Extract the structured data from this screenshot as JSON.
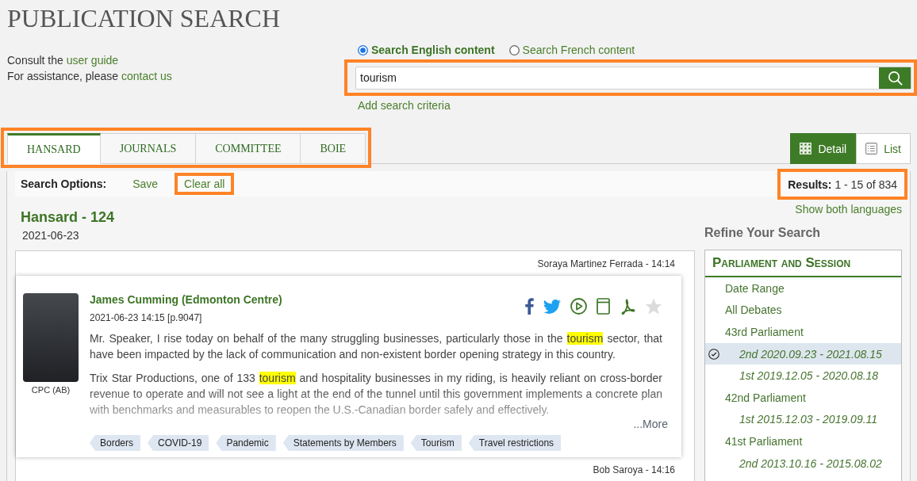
{
  "page": {
    "title": "PUBLICATION SEARCH",
    "help": [
      {
        "text": "Consult the",
        "link": "user guide"
      },
      {
        "text": "For assistance, please",
        "link": "contact us"
      }
    ]
  },
  "search": {
    "languages": [
      {
        "label": "Search English content",
        "selected": true
      },
      {
        "label": "Search French content",
        "selected": false
      }
    ],
    "query": "tourism",
    "highlighted": true,
    "add_criteria": "Add search criteria"
  },
  "tabs": {
    "highlighted": true,
    "items": [
      {
        "label": "HANSARD",
        "selected": true
      },
      {
        "label": "JOURNALS",
        "selected": false
      },
      {
        "label": "COMMITTEE",
        "selected": false
      },
      {
        "label": "BOIE",
        "selected": false
      }
    ]
  },
  "view_toggle": [
    {
      "kind": "grid",
      "label": "Detail",
      "selected": true
    },
    {
      "kind": "list",
      "label": "List",
      "selected": false
    }
  ],
  "search_options": {
    "label": "Search Options:",
    "actions": [
      {
        "label": "Save",
        "highlighted": false
      },
      {
        "label": "Clear all",
        "highlighted": true
      }
    ],
    "results": {
      "label": "Results:",
      "value": "1 - 15 of 834",
      "highlighted": true
    }
  },
  "show_both_languages": "Show both languages",
  "results": {
    "title": "Hansard - 124",
    "date": "2021-06-23",
    "items": [
      {
        "kind": "speaker_line",
        "text": "Soraya Martinez Ferrada - 14:14"
      },
      {
        "kind": "intervention",
        "name": "James Cumming (Edmonton Centre)",
        "affiliation": "CPC (AB)",
        "timestamp": "2021-06-23 14:15 [p.9047]",
        "favorite": false,
        "paragraphs": [
          [
            {
              "text": "Mr. Speaker, I rise today on behalf of the many struggling businesses, particularly those in the ",
              "match": false
            },
            {
              "text": "tourism",
              "match": true
            },
            {
              "text": " sector, that have been impacted by the lack of communication and non-existent border opening strategy in this country.",
              "match": false
            }
          ],
          [
            {
              "text": "Trix Star Productions, one of 133 ",
              "match": false
            },
            {
              "text": "tourism",
              "match": true
            },
            {
              "text": " and hospitality businesses in my riding, is heavily reliant on cross-border revenue to operate and will not see a light at the end of the tunnel until this government implements a concrete plan with benchmarks and measurables to reopen the U.S.-Canadian border safely and effectively.",
              "match": false
            }
          ]
        ],
        "more": "...More",
        "tags": [
          "Borders",
          "COVID-19",
          "Pandemic",
          "Statements by Members",
          "Tourism",
          "Travel restrictions"
        ]
      },
      {
        "kind": "speaker_line",
        "text": "Bob Saroya - 14:16"
      }
    ]
  },
  "refine": {
    "title": "Refine Your Search",
    "facet": {
      "title": "Parliament and Session",
      "items": [
        {
          "label": "Date Range",
          "selected": false
        },
        {
          "label": "All Debates",
          "selected": false
        },
        {
          "label": "43rd Parliament",
          "selected": false,
          "children": [
            {
              "label": "2nd 2020.09.23 - 2021.08.15",
              "selected": true
            },
            {
              "label": "1st 2019.12.05 - 2020.08.18",
              "selected": false
            }
          ]
        },
        {
          "label": "42nd Parliament",
          "selected": false,
          "children": [
            {
              "label": "1st 2015.12.03 - 2019.09.11",
              "selected": false
            }
          ]
        },
        {
          "label": "41st Parliament",
          "selected": false,
          "children": [
            {
              "label": "2nd 2013.10.16 - 2015.08.02",
              "selected": false
            }
          ]
        }
      ]
    }
  }
}
